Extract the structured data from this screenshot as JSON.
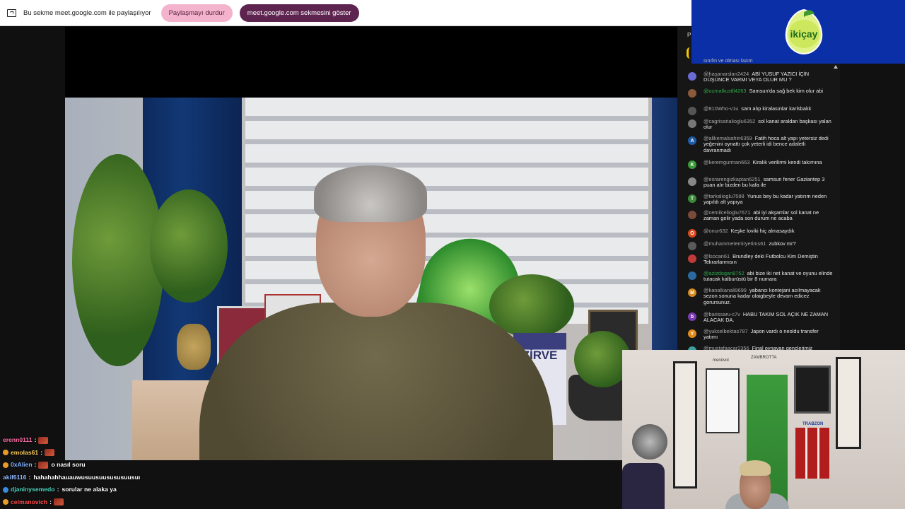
{
  "sharebar": {
    "message": "Bu sekme meet.google.com ile paylaşılıyor",
    "stop_label": "Paylaşmayı durdur",
    "show_label": "meet.google.com sekmesini göster"
  },
  "logo": {
    "text": "ikiçay"
  },
  "book": {
    "title": "ZİRVE"
  },
  "cam_labels": {
    "trabzon": "TRABZON",
    "zambrotta": "ZAMBROTTA",
    "menuvol": "menüvol"
  },
  "yt_header": {
    "p_label": "P"
  },
  "yt_chat": {
    "top_fragment": "sınıfın ve olması lazım",
    "messages": [
      {
        "author": "@hasanarslan2424",
        "text": "ABİ YUSUF YAZICI İÇİN DÜŞÜNCE VARMI VEYA OLUR MU ?",
        "avatar": "#6b6bd6",
        "initial": ""
      },
      {
        "author": "@ozmalkustll4263",
        "text": "Samsun'da sağ bek kim olur abi",
        "avatar": "#8a5a3a",
        "initial": "",
        "green": true
      },
      {
        "author": "@810Who-v1u",
        "text": "sam alıp kiralasınlar karlsbakk",
        "avatar": "#555",
        "initial": ""
      },
      {
        "author": "@cagrisarialioglu6352",
        "text": "sol kanat araldan başkası yalan olur",
        "avatar": "#777",
        "initial": ""
      },
      {
        "author": "@alikemalsahin6359",
        "text": "Fatih hoca alt yapı yetersiz dedi yeğenini oynattı çok yeterli idi bence adaletli davranmadı",
        "avatar": "#1e5aa8",
        "initial": "A"
      },
      {
        "author": "@keremgurman663",
        "text": "Kiralık verilirmi kendi takımına",
        "avatar": "#3a9a3a",
        "initial": "K"
      },
      {
        "author": "@esrarengizkaptan6251",
        "text": "samsun fener Gaziantep 3 puan alır bizden bu kafa ile",
        "avatar": "#888",
        "initial": ""
      },
      {
        "author": "@tarkalioglu7588",
        "text": "Yunus bey bu kadar yatırım neden yapıldı alt yapıya",
        "avatar": "#3a8a3a",
        "initial": "T"
      },
      {
        "author": "@cemilcelioglu7671",
        "text": "abi iyi akşamlar sol kanat ne zaman gelir yada son durum ne acaba",
        "avatar": "#7a4a3a",
        "initial": ""
      },
      {
        "author": "@onur632",
        "text": "Keşke loviki hiç almasaydık",
        "avatar": "#d64a1e",
        "initial": "O"
      },
      {
        "author": "@muhammetemiryetims61",
        "text": "zubkov mr?",
        "avatar": "#5a5a5a",
        "initial": ""
      },
      {
        "author": "@lsocan61",
        "text": "Brundley deki Futbolcu Kim Demiştin Tekrarlarmısın",
        "avatar": "#c03a3a",
        "initial": ""
      },
      {
        "author": "@azizdogan8752",
        "text": "abi bize iki net kanat ve oyunu elinde tutacak kalburüstü bir 8 numara",
        "avatar": "#2a6aa0",
        "initial": "",
        "green": true
      },
      {
        "author": "@kanalkanali9699",
        "text": "yabancı kontejani acılmayacak sezon sonuna kadar olaigbeyle devam edicez gorursunuz.",
        "avatar": "#d68a1e",
        "initial": "M"
      },
      {
        "author": "@barissaru-c7v",
        "text": "HABU TAKIM SOL AÇIK NE ZAMAN ALACAK DA.",
        "avatar": "#7a3ab0",
        "initial": "b"
      },
      {
        "author": "@yukselbektas787",
        "text": "Japon vardı o neoldu transfer yatımı",
        "avatar": "#e08a1e",
        "initial": "Y"
      },
      {
        "author": "@mustafaacar2356",
        "text": "Final oynayan gençlerimiz",
        "avatar": "#3aa0a0",
        "initial": ""
      }
    ]
  },
  "video_chat": [
    {
      "user": "erenn0111",
      "color": "#ff6fa8",
      "text": "",
      "emote": true,
      "badge": ""
    },
    {
      "user": "emolas61",
      "color": "#ffcf5a",
      "text": "",
      "emote": true,
      "badge": "#e89a2a"
    },
    {
      "user": "0xAlien",
      "color": "#7fb0ff",
      "text": "o nasıl soru",
      "emote": true,
      "badge": "#e89a2a"
    },
    {
      "user": "akif6116",
      "color": "#8fb8ff",
      "text": "hahahahhauauwusuusuusususuusuı",
      "emote": false,
      "badge": ""
    },
    {
      "user": "djaninysemedo",
      "color": "#4ad6c0",
      "text": "sorular ne alaka ya",
      "emote": false,
      "badge": "#3a8ae0"
    },
    {
      "user": "celmanovich",
      "color": "#ff4a4a",
      "text": "",
      "emote": true,
      "badge": "#e89a2a"
    }
  ]
}
